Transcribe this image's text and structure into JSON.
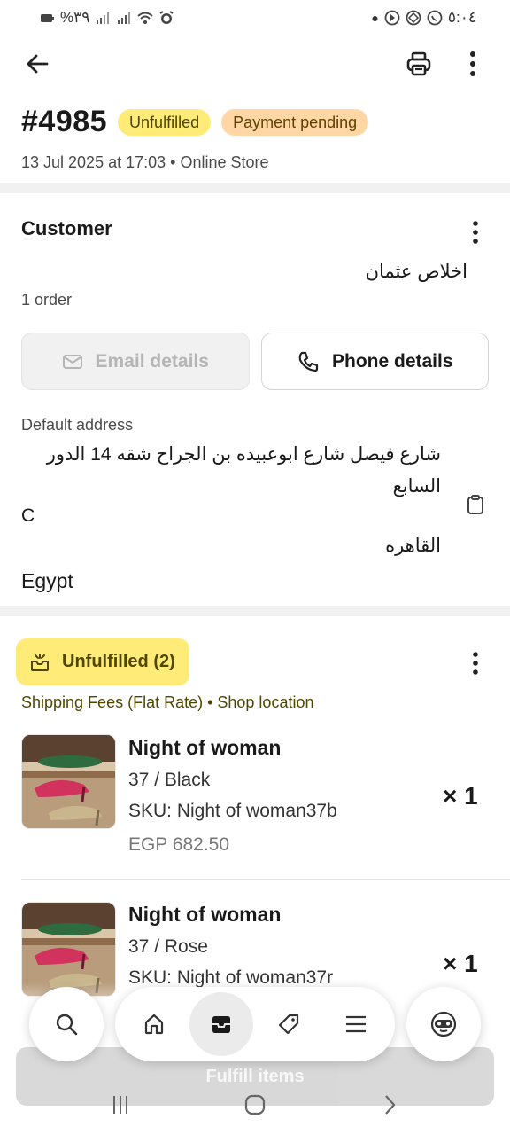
{
  "status_bar": {
    "left_text": "%٣٩",
    "right_time": "٥:٠٤"
  },
  "app_bar": {
    "back_icon": "arrow-left-icon",
    "print_icon": "printer-icon",
    "more_icon": "more-vertical-icon"
  },
  "order": {
    "number": "#4985",
    "fulfillment_badge": "Unfulfilled",
    "payment_badge": "Payment pending",
    "meta": "13 Jul 2025 at 17:03 • Online Store",
    "colors": {
      "unfulfilled_badge": "#ffeb78",
      "payment_badge": "#ffd6a4"
    }
  },
  "customer": {
    "title": "Customer",
    "name": "اخلاص عثمان",
    "orders": "1 order",
    "email_button": "Email details",
    "phone_button": "Phone details",
    "address_label": "Default address",
    "address_line1": "شارع فيصل شارع ابوعبيده بن الجراح شقه 14 الدور السابع",
    "address_line2": "C",
    "address_city": "القاهره",
    "address_country": "Egypt"
  },
  "fulfillment": {
    "status_chip": "Unfulfilled (2)",
    "shipping_line": "Shipping Fees (Flat Rate) • Shop location",
    "items": [
      {
        "name": "Night of woman",
        "variant": "37 / Black",
        "sku": "SKU: Night of woman37b",
        "price": "EGP 682.50",
        "quantity": "× 1"
      },
      {
        "name": "Night of woman",
        "variant": "37 / Rose",
        "sku": "SKU: Night of woman37r",
        "quantity": "× 1"
      }
    ],
    "fulfill_button": "Fulfill items"
  },
  "bottom_nav": {
    "items": [
      "search-icon",
      "home-icon",
      "orders-icon",
      "tag-icon",
      "menu-icon"
    ],
    "active": "orders-icon",
    "assistant_icon": "assistant-icon"
  }
}
